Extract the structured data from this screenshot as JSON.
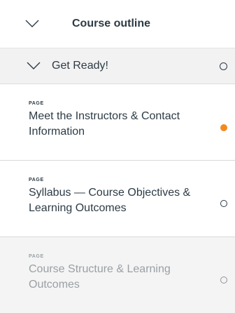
{
  "outline": {
    "title": "Course outline",
    "toggle_icon": "chevron-down-icon"
  },
  "section": {
    "label": "Get Ready!",
    "toggle_icon": "chevron-down-icon",
    "status_icon": "circle-outline-icon"
  },
  "items": [
    {
      "kind": "PAGE",
      "title": "Meet the Instructors & Contact Information",
      "status": "current",
      "status_icon": "dot-filled-icon",
      "status_color": "#f28a1e"
    },
    {
      "kind": "PAGE",
      "title": "Syllabus — Course Objectives & Learning Outcomes",
      "status": "not-started",
      "status_icon": "circle-outline-icon"
    },
    {
      "kind": "PAGE",
      "title": "Course Structure & Learning Outcomes",
      "status": "not-started",
      "status_icon": "circle-outline-icon"
    }
  ],
  "colors": {
    "text": "#2d3b45",
    "muted": "#9aa0a4",
    "accent": "#f28a1e",
    "background": "#f4f4f4"
  }
}
